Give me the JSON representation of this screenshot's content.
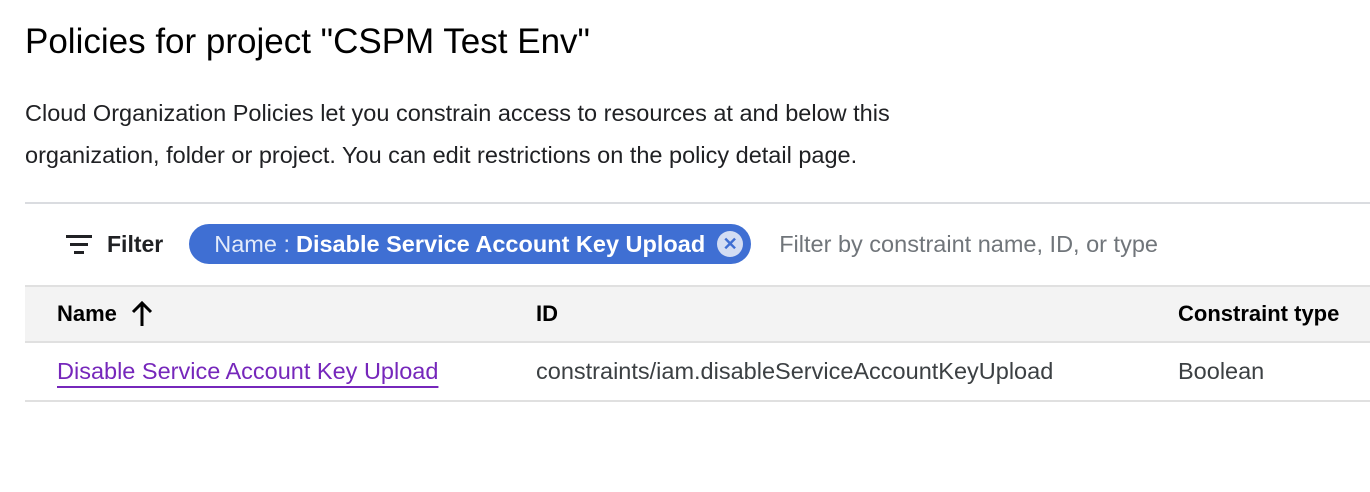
{
  "header": {
    "title": "Policies for project \"CSPM Test Env\"",
    "description": "Cloud Organization Policies let you constrain access to resources at and below this organization, folder or project. You can edit restrictions on the policy detail page."
  },
  "filter": {
    "label": "Filter",
    "icon": "filter-list-icon",
    "chip": {
      "key": "Name :",
      "value": "Disable Service Account Key Upload"
    },
    "placeholder": "Filter by constraint name, ID, or type"
  },
  "table": {
    "columns": [
      "Name",
      "ID",
      "Constraint type"
    ],
    "sort": {
      "column": "Name",
      "direction": "ascending"
    },
    "rows": [
      {
        "name": "Disable Service Account Key Upload",
        "id": "constraints/iam.disableServiceAccountKeyUpload",
        "type": "Boolean"
      }
    ]
  },
  "colors": {
    "chip": "#3f6fd3",
    "link": "#7627bb"
  }
}
